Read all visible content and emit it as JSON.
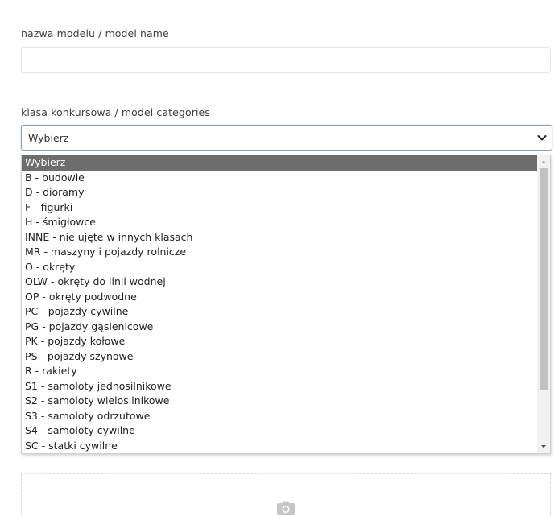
{
  "form": {
    "model_name": {
      "label": "nazwa modelu / model name",
      "value": "",
      "placeholder": ""
    },
    "category": {
      "label": "klasa konkursowa / model categories",
      "selected_value": "Wybierz",
      "options": [
        "Wybierz",
        "B - budowle",
        "D - dioramy",
        "F - figurki",
        "H - śmigłowce",
        "INNE - nie ujęte w innych klasach",
        "MR - maszyny i pojazdy rolnicze",
        "O - okręty",
        "OLW - okręty do linii wodnej",
        "OP - okręty podwodne",
        "PC - pojazdy cywilne",
        "PG - pojazdy gąsienicowe",
        "PK - pojazdy kołowe",
        "PS - pojazdy szynowe",
        "R - rakiety",
        "S1 - samoloty jednosilnikowe",
        "S2 - samoloty wielosilnikowe",
        "S3 - samoloty odrzutowe",
        "S4 - samoloty cywilne",
        "SC - statki cywilne"
      ]
    },
    "upload": {
      "icon": "camera-icon"
    }
  },
  "colors": {
    "selected_option_bg": "#6d6d6d",
    "select_border": "#8aa2c0"
  }
}
